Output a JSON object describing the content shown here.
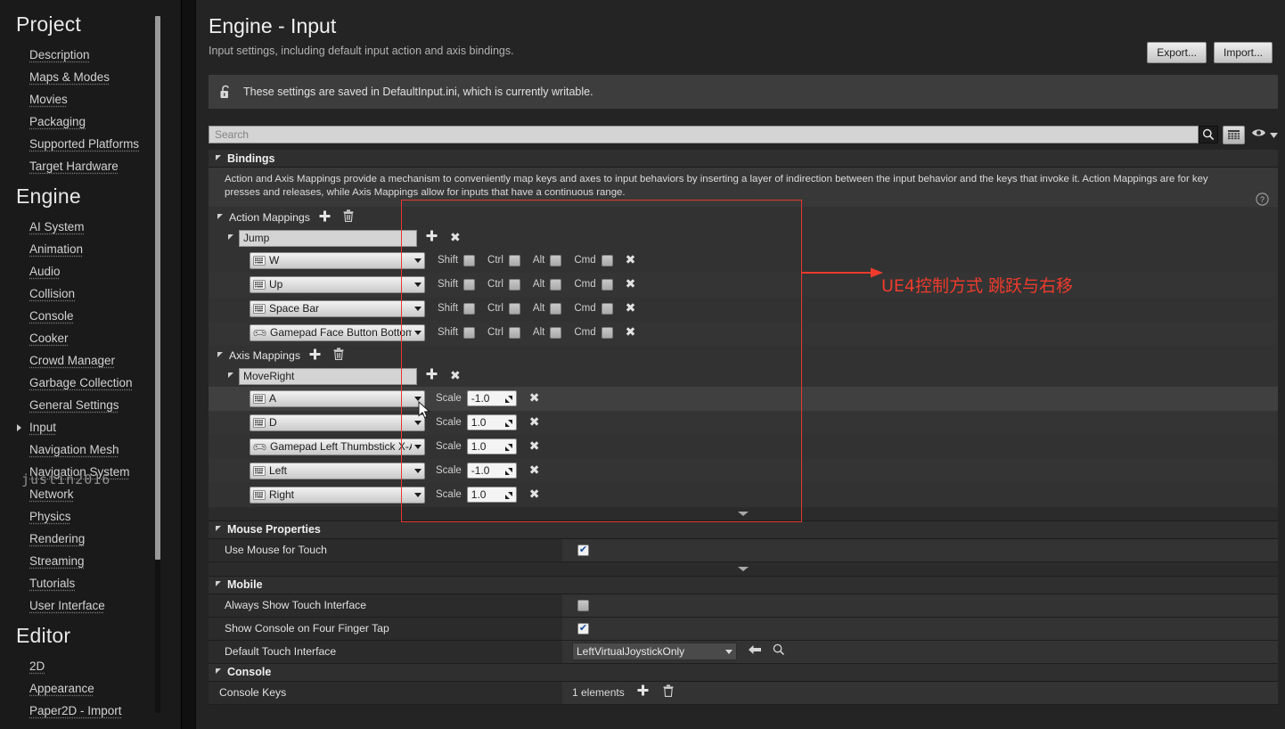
{
  "sidebar": {
    "groups": [
      {
        "title": "Project",
        "items": [
          {
            "label": "Description",
            "expandable": false
          },
          {
            "label": "Maps & Modes",
            "expandable": false
          },
          {
            "label": "Movies",
            "expandable": false
          },
          {
            "label": "Packaging",
            "expandable": false
          },
          {
            "label": "Supported Platforms",
            "expandable": false
          },
          {
            "label": "Target Hardware",
            "expandable": false
          }
        ]
      },
      {
        "title": "Engine",
        "items": [
          {
            "label": "AI System",
            "expandable": false
          },
          {
            "label": "Animation",
            "expandable": false
          },
          {
            "label": "Audio",
            "expandable": false
          },
          {
            "label": "Collision",
            "expandable": false
          },
          {
            "label": "Console",
            "expandable": false
          },
          {
            "label": "Cooker",
            "expandable": false
          },
          {
            "label": "Crowd Manager",
            "expandable": false
          },
          {
            "label": "Garbage Collection",
            "expandable": false
          },
          {
            "label": "General Settings",
            "expandable": false
          },
          {
            "label": "Input",
            "expandable": true
          },
          {
            "label": "Navigation Mesh",
            "expandable": false
          },
          {
            "label": "Navigation System",
            "expandable": false
          },
          {
            "label": "Network",
            "expandable": false
          },
          {
            "label": "Physics",
            "expandable": false
          },
          {
            "label": "Rendering",
            "expandable": false
          },
          {
            "label": "Streaming",
            "expandable": false
          },
          {
            "label": "Tutorials",
            "expandable": false
          },
          {
            "label": "User Interface",
            "expandable": false
          }
        ]
      },
      {
        "title": "Editor",
        "items": [
          {
            "label": "2D",
            "expandable": false
          },
          {
            "label": "Appearance",
            "expandable": false
          },
          {
            "label": "Paper2D - Import",
            "expandable": false
          }
        ]
      }
    ]
  },
  "watermark": "justin2016",
  "header": {
    "title": "Engine - Input",
    "subtitle": "Input settings, including default input action and axis bindings.",
    "export_label": "Export...",
    "import_label": "Import...",
    "notice": "These settings are saved in DefaultInput.ini, which is currently writable."
  },
  "search": {
    "placeholder": "Search",
    "value": ""
  },
  "bindings": {
    "title": "Bindings",
    "description": "Action and Axis Mappings provide a mechanism to conveniently map keys and axes to input behaviors by inserting a layer of indirection between the input behavior and the keys that invoke it. Action Mappings are for key presses and releases, while Axis Mappings allow for inputs that have a continuous range.",
    "action_mappings": {
      "title": "Action Mappings",
      "groups": [
        {
          "name": "Jump",
          "keys": [
            {
              "key": "W",
              "device": "keyboard",
              "shift": false,
              "ctrl": false,
              "alt": false,
              "cmd": false
            },
            {
              "key": "Up",
              "device": "keyboard",
              "shift": false,
              "ctrl": false,
              "alt": false,
              "cmd": false
            },
            {
              "key": "Space Bar",
              "device": "keyboard",
              "shift": false,
              "ctrl": false,
              "alt": false,
              "cmd": false
            },
            {
              "key": "Gamepad Face Button Bottom",
              "device": "gamepad",
              "shift": false,
              "ctrl": false,
              "alt": false,
              "cmd": false
            }
          ]
        }
      ],
      "modifier_labels": [
        "Shift",
        "Ctrl",
        "Alt",
        "Cmd"
      ]
    },
    "axis_mappings": {
      "title": "Axis Mappings",
      "scale_label": "Scale",
      "groups": [
        {
          "name": "MoveRight",
          "keys": [
            {
              "key": "A",
              "device": "keyboard",
              "scale": "-1.0",
              "highlighted": true
            },
            {
              "key": "D",
              "device": "keyboard",
              "scale": "1.0",
              "highlighted": false
            },
            {
              "key": "Gamepad Left Thumbstick X-Axis",
              "device": "gamepad",
              "scale": "1.0",
              "highlighted": false
            },
            {
              "key": "Left",
              "device": "keyboard",
              "scale": "-1.0",
              "highlighted": false
            },
            {
              "key": "Right",
              "device": "keyboard",
              "scale": "1.0",
              "highlighted": false
            }
          ]
        }
      ]
    }
  },
  "mouse_properties": {
    "title": "Mouse Properties",
    "rows": [
      {
        "label": "Use Mouse for Touch",
        "checked": true
      }
    ]
  },
  "mobile": {
    "title": "Mobile",
    "rows": [
      {
        "label": "Always Show Touch Interface",
        "type": "checkbox",
        "checked": false
      },
      {
        "label": "Show Console on Four Finger Tap",
        "type": "checkbox",
        "checked": true
      },
      {
        "label": "Default Touch Interface",
        "type": "select",
        "value": "LeftVirtualJoystickOnly"
      }
    ]
  },
  "console": {
    "title": "Console",
    "rows": [
      {
        "label": "Console Keys",
        "elements": "1 elements"
      }
    ]
  },
  "annotation": {
    "text": "UE4控制方式 跳跃与右移",
    "color": "#ef3b2d"
  },
  "colors": {
    "panel_bg": "#242424",
    "sidebar_bg": "#1a1a1a",
    "row_bg": "#2b2b2b",
    "header_bg": "#2f2f2f",
    "accent_red": "#ef3b2d"
  }
}
